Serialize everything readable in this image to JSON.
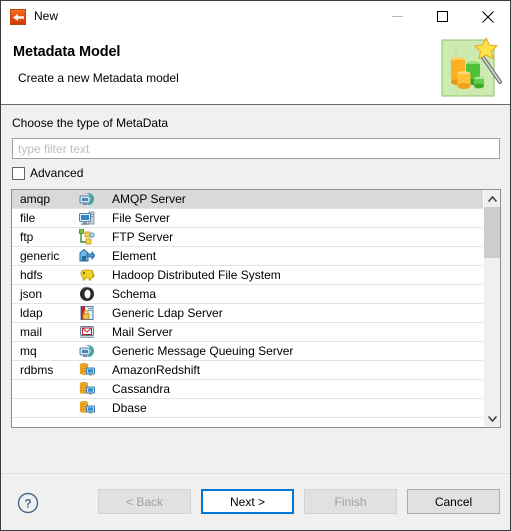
{
  "window": {
    "title": "New",
    "icon": "talend-logo-icon",
    "controls": {
      "minimize": "minimize-icon",
      "maximize": "maximize-icon",
      "close": "close-icon"
    }
  },
  "header": {
    "title": "Metadata Model",
    "subtitle": "Create a new Metadata model",
    "banner_icon": "metadata-wizard-icon"
  },
  "form": {
    "choose_label": "Choose the type of MetaData",
    "filter": {
      "value": "",
      "placeholder": "type filter text"
    },
    "advanced": {
      "label": "Advanced",
      "checked": false
    }
  },
  "list": {
    "selected_index": 0,
    "rows": [
      {
        "key": "amqp",
        "icon": "amqp-server-icon",
        "label": "AMQP Server"
      },
      {
        "key": "file",
        "icon": "file-server-icon",
        "label": "File Server"
      },
      {
        "key": "ftp",
        "icon": "ftp-server-icon",
        "label": "FTP Server"
      },
      {
        "key": "generic",
        "icon": "generic-element-icon",
        "label": "Element"
      },
      {
        "key": "hdfs",
        "icon": "hadoop-icon",
        "label": "Hadoop Distributed File System"
      },
      {
        "key": "json",
        "icon": "json-schema-icon",
        "label": "Schema"
      },
      {
        "key": "ldap",
        "icon": "ldap-server-icon",
        "label": "Generic Ldap Server"
      },
      {
        "key": "mail",
        "icon": "mail-server-icon",
        "label": "Mail Server"
      },
      {
        "key": "mq",
        "icon": "mq-server-icon",
        "label": "Generic Message Queuing Server"
      },
      {
        "key": "rdbms",
        "icon": "database-icon",
        "label": "AmazonRedshift"
      },
      {
        "key": "",
        "icon": "database-icon",
        "label": "Cassandra"
      },
      {
        "key": "",
        "icon": "database-icon",
        "label": "Dbase"
      }
    ],
    "scrollbar": {
      "up_arrow": "chevron-up-icon",
      "down_arrow": "chevron-down-icon"
    }
  },
  "buttons": {
    "help": "help-icon",
    "back": {
      "label": "< Back",
      "enabled": false
    },
    "next": {
      "label": "Next >",
      "enabled": true,
      "default": true
    },
    "finish": {
      "label": "Finish",
      "enabled": false
    },
    "cancel": {
      "label": "Cancel",
      "enabled": true
    }
  },
  "colors": {
    "accent": "#0078d7",
    "selection": "#d9d9d9",
    "body": "#f0f0f0"
  }
}
